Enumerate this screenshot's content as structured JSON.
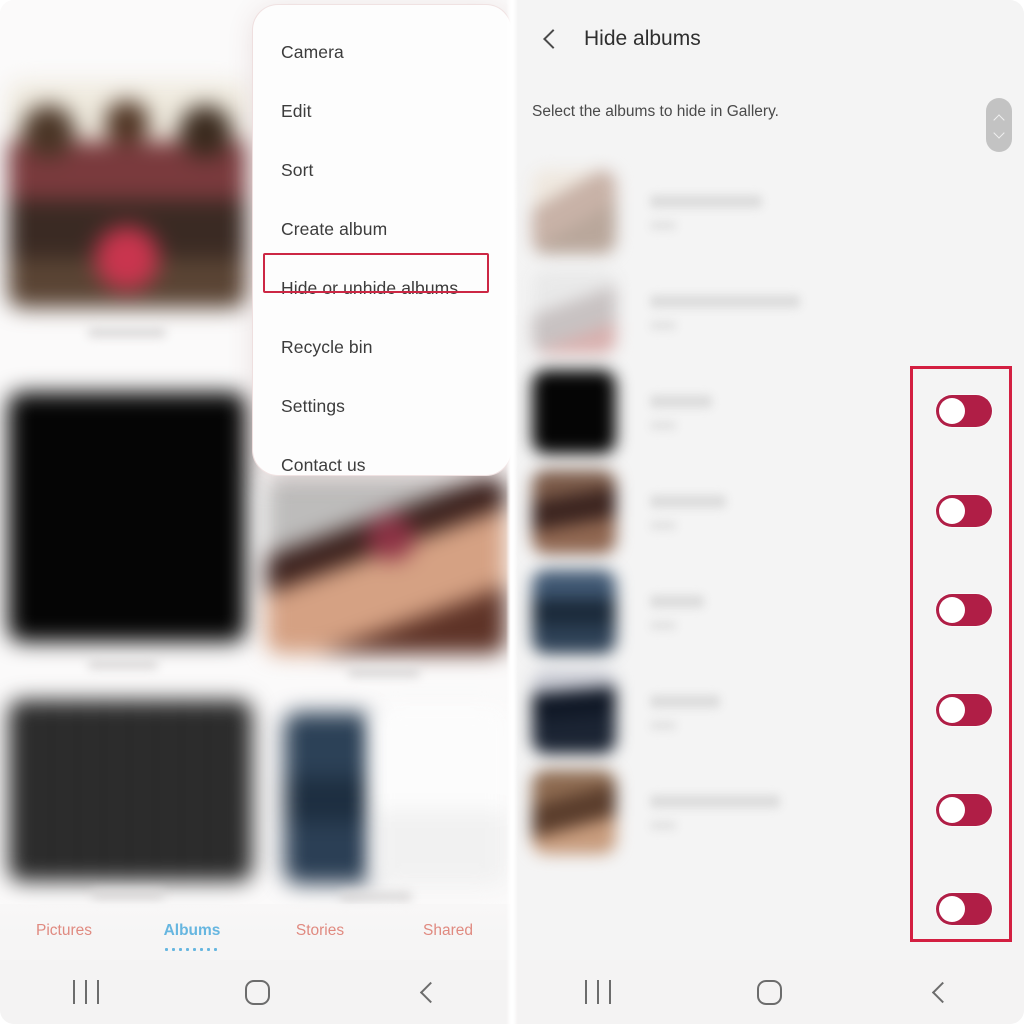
{
  "left_panel": {
    "app": "Gallery",
    "menu": {
      "items": [
        {
          "label": "Camera"
        },
        {
          "label": "Edit"
        },
        {
          "label": "Sort"
        },
        {
          "label": "Create album"
        },
        {
          "label": "Hide or unhide albums",
          "highlighted": true
        },
        {
          "label": "Recycle bin"
        },
        {
          "label": "Settings"
        },
        {
          "label": "Contact us"
        }
      ],
      "highlight_color": "#cc2744"
    },
    "tabs": [
      {
        "label": "Pictures",
        "active": false
      },
      {
        "label": "Albums",
        "active": true
      },
      {
        "label": "Stories",
        "active": false
      },
      {
        "label": "Shared",
        "active": false
      }
    ],
    "tab_colors": {
      "inactive": "#e08a80",
      "active": "#66b6e0"
    },
    "thumbnails": [
      {
        "name": "group-photo",
        "blurred": true
      },
      {
        "name": "black-image",
        "blurred": true
      },
      {
        "name": "portrait-photo",
        "blurred": true
      },
      {
        "name": "dark-poster",
        "blurred": true
      },
      {
        "name": "navy-screenshot",
        "blurred": true
      }
    ]
  },
  "right_panel": {
    "header": {
      "back_icon": "back-chevron-icon",
      "title": "Hide albums"
    },
    "description": "Select the albums to hide in Gallery.",
    "scrollbar": {
      "up_icon": "chevron-up-icon",
      "down_icon": "chevron-down-icon"
    },
    "albums": [
      {
        "name": "",
        "count": "",
        "toggle_on": false,
        "thumb": "a0"
      },
      {
        "name": "",
        "count": "",
        "toggle_on": false,
        "thumb": "a1"
      },
      {
        "name": "",
        "count": "",
        "toggle_on": false,
        "thumb": "a2"
      },
      {
        "name": "",
        "count": "",
        "toggle_on": false,
        "thumb": "a3"
      },
      {
        "name": "",
        "count": "",
        "toggle_on": false,
        "thumb": "a4"
      },
      {
        "name": "",
        "count": "",
        "toggle_on": false,
        "thumb": "a5"
      },
      {
        "name": "",
        "count": "",
        "toggle_on": false,
        "thumb": "a6"
      }
    ],
    "toggle_color": "#b01e46",
    "highlight_color": "#d31f41",
    "toggle_count": 6
  },
  "navbar": {
    "recents_label": "recent-apps",
    "home_label": "home",
    "back_label": "back"
  }
}
